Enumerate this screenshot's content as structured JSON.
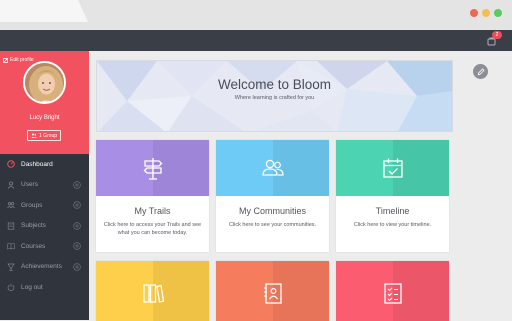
{
  "colors": {
    "brand_red": "#f25260",
    "sidebar_bg": "#30343c",
    "topbar_bg": "#3a3e47",
    "trails": "#a98ee5",
    "communities": "#6ecbf5",
    "timeline": "#4cd3b2",
    "yellow": "#fecf4a",
    "orange": "#f67c5e",
    "pink": "#fb5c70"
  },
  "notifications": {
    "count": "2",
    "icon": "notification-icon"
  },
  "profile": {
    "edit_label": "Edit profile",
    "name": "Lucy Bright",
    "group_label": "1 Group"
  },
  "nav": {
    "items": [
      {
        "label": "Dashboard",
        "icon": "dashboard-icon",
        "active": true,
        "plus": false
      },
      {
        "label": "Users",
        "icon": "users-icon",
        "active": false,
        "plus": true
      },
      {
        "label": "Groups",
        "icon": "groups-icon",
        "active": false,
        "plus": true
      },
      {
        "label": "Subjects",
        "icon": "subjects-icon",
        "active": false,
        "plus": true
      },
      {
        "label": "Courses",
        "icon": "courses-icon",
        "active": false,
        "plus": true
      },
      {
        "label": "Achievements",
        "icon": "achievements-icon",
        "active": false,
        "plus": true
      },
      {
        "label": "Log out",
        "icon": "logout-icon",
        "active": false,
        "plus": false
      }
    ]
  },
  "welcome": {
    "title": "Welcome to Bloom",
    "subtitle": "Where learning is crafted for you"
  },
  "cards": [
    {
      "title": "My Trails",
      "description": "Click here to access your Trails and see what you can become today.",
      "icon": "signpost-icon"
    },
    {
      "title": "My Communities",
      "description": "Click here to see your communities.",
      "icon": "community-icon"
    },
    {
      "title": "Timeline",
      "description": "Click here to view your timeline.",
      "icon": "calendar-icon"
    }
  ],
  "bottom_cards": [
    {
      "icon": "books-icon"
    },
    {
      "icon": "address-book-icon"
    },
    {
      "icon": "checklist-icon"
    }
  ]
}
